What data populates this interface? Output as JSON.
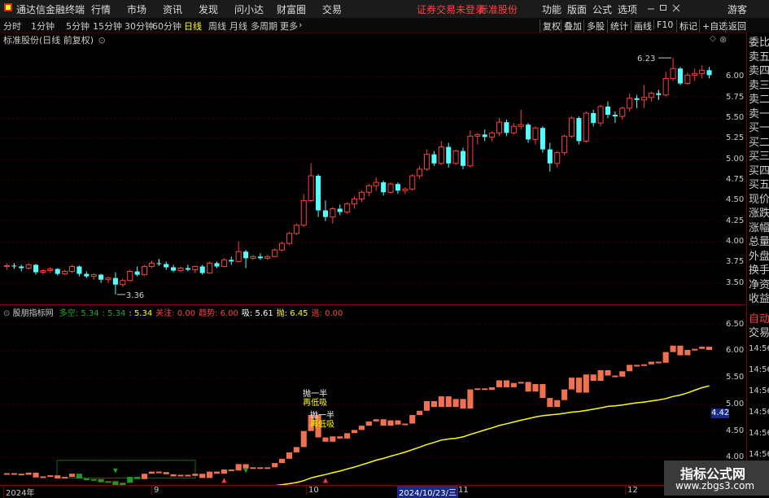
{
  "menubar": {
    "app_title": "通达信金融终端",
    "menus": [
      "行情",
      "市场",
      "资讯",
      "发现",
      "问小达",
      "财富圈",
      "交易"
    ],
    "status_warning": "证券交易未登录",
    "stock_name": "标准股份",
    "right_menus": [
      "功能",
      "版面",
      "公式",
      "选项"
    ],
    "user": "游客",
    "window_controls": [
      "minimize",
      "restore",
      "close"
    ]
  },
  "periodbar": {
    "periods": [
      "分时",
      "1分钟",
      "5分钟",
      "15分钟",
      "30分钟",
      "60分钟",
      "日线",
      "周线",
      "月线",
      "多周期",
      "更多"
    ],
    "active": "日线",
    "right_buttons": [
      "复权",
      "叠加",
      "多股",
      "统计",
      "画线",
      "F10",
      "标记",
      "+自选",
      "返回"
    ]
  },
  "main_chart": {
    "title": "标准股份(日线 前复权)",
    "high_label": "6.23",
    "low_label": "3.36",
    "price_axis": [
      "6.00",
      "5.75",
      "5.50",
      "5.25",
      "5.00",
      "4.75",
      "4.50",
      "4.25",
      "4.00",
      "3.75",
      "3.50"
    ]
  },
  "indicator": {
    "name": "股朋指标网",
    "vals": [
      {
        "label": "多空",
        "value": "5.34",
        "color": "#22aa22"
      },
      {
        "label": "",
        "value": "5.34",
        "color": "#22aa22"
      },
      {
        "label": "",
        "value": "5.34",
        "color": "#ffff00"
      },
      {
        "label": "关注",
        "value": "0.00",
        "color": "#ff4040"
      },
      {
        "label": "趋势",
        "value": "6.00",
        "color": "#ff4040"
      },
      {
        "label": "吸",
        "value": "5.61",
        "color": "#ffffff"
      },
      {
        "label": "抛",
        "value": "6.45",
        "color": "#ffff00"
      },
      {
        "label": "逃",
        "value": "0.00",
        "color": "#ff4040"
      }
    ],
    "axis": [
      "6.50",
      "6.00",
      "5.50",
      "5.00",
      "4.50",
      "4.00"
    ],
    "current_price": "4.42",
    "annotations": [
      {
        "text1": "抛一半",
        "text2": "再低吸"
      },
      {
        "text1": "抛一半",
        "text2": "再低吸"
      }
    ]
  },
  "time_axis": {
    "labels": [
      "2024年",
      "9",
      "10",
      "2024/10/23/三",
      "11",
      "12"
    ],
    "highlighted": "2024/10/23/三"
  },
  "right_panel": {
    "labels": [
      "委比",
      "卖五",
      "卖四",
      "卖三",
      "卖二",
      "卖一",
      "买一",
      "买二",
      "买三",
      "买四",
      "买五",
      "现价",
      "涨跌",
      "涨幅",
      "总量",
      "外盘",
      "换手",
      "净资",
      "收益"
    ],
    "auto_label": "自动",
    "trade_label": "交易",
    "time_ticks": [
      "14:56",
      "14:56",
      "14:56",
      "14:56",
      "14:56",
      "14:56",
      "14:56"
    ]
  },
  "watermark": {
    "title": "指标公式网",
    "url": "www.zbgs3.com"
  },
  "chart_data": {
    "type": "candlestick",
    "title": "标准股份(日线 前复权)",
    "series": [
      {
        "name": "",
        "candles": [
          [
            3.7,
            3.74,
            3.66,
            3.71
          ],
          [
            3.71,
            3.74,
            3.67,
            3.7
          ],
          [
            3.7,
            3.72,
            3.64,
            3.68
          ],
          [
            3.68,
            3.74,
            3.66,
            3.72
          ],
          [
            3.72,
            3.73,
            3.6,
            3.63
          ],
          [
            3.63,
            3.67,
            3.6,
            3.65
          ],
          [
            3.65,
            3.69,
            3.62,
            3.67
          ],
          [
            3.67,
            3.68,
            3.59,
            3.61
          ],
          [
            3.61,
            3.66,
            3.6,
            3.64
          ],
          [
            3.64,
            3.72,
            3.62,
            3.7
          ],
          [
            3.7,
            3.71,
            3.58,
            3.61
          ],
          [
            3.61,
            3.64,
            3.56,
            3.58
          ],
          [
            3.58,
            3.62,
            3.54,
            3.6
          ],
          [
            3.6,
            3.61,
            3.5,
            3.54
          ],
          [
            3.54,
            3.58,
            3.5,
            3.56
          ],
          [
            3.56,
            3.63,
            3.36,
            3.48
          ],
          [
            3.48,
            3.55,
            3.45,
            3.53
          ],
          [
            3.53,
            3.66,
            3.52,
            3.64
          ],
          [
            3.64,
            3.7,
            3.58,
            3.6
          ],
          [
            3.6,
            3.72,
            3.59,
            3.7
          ],
          [
            3.7,
            3.77,
            3.68,
            3.74
          ],
          [
            3.74,
            3.79,
            3.71,
            3.73
          ],
          [
            3.73,
            3.76,
            3.66,
            3.69
          ],
          [
            3.69,
            3.72,
            3.63,
            3.65
          ],
          [
            3.65,
            3.7,
            3.63,
            3.68
          ],
          [
            3.68,
            3.72,
            3.64,
            3.66
          ],
          [
            3.66,
            3.71,
            3.62,
            3.7
          ],
          [
            3.7,
            3.72,
            3.6,
            3.62
          ],
          [
            3.62,
            3.76,
            3.61,
            3.74
          ],
          [
            3.74,
            3.76,
            3.68,
            3.7
          ],
          [
            3.7,
            3.8,
            3.69,
            3.78
          ],
          [
            3.78,
            3.82,
            3.72,
            3.76
          ],
          [
            3.76,
            4.0,
            3.75,
            3.88
          ],
          [
            3.88,
            3.9,
            3.68,
            3.8
          ],
          [
            3.8,
            3.84,
            3.78,
            3.82
          ],
          [
            3.82,
            3.86,
            3.78,
            3.8
          ],
          [
            3.8,
            3.84,
            3.78,
            3.82
          ],
          [
            3.82,
            3.92,
            3.81,
            3.9
          ],
          [
            3.9,
            4.0,
            3.88,
            3.98
          ],
          [
            3.98,
            4.12,
            3.96,
            4.1
          ],
          [
            4.1,
            4.22,
            4.08,
            4.2
          ],
          [
            4.2,
            4.58,
            4.18,
            4.5
          ],
          [
            4.5,
            4.95,
            4.48,
            4.8
          ],
          [
            4.8,
            4.82,
            4.3,
            4.38
          ],
          [
            4.38,
            4.5,
            4.25,
            4.3
          ],
          [
            4.3,
            4.42,
            4.22,
            4.4
          ],
          [
            4.4,
            4.45,
            4.32,
            4.36
          ],
          [
            4.36,
            4.48,
            4.34,
            4.46
          ],
          [
            4.46,
            4.55,
            4.4,
            4.52
          ],
          [
            4.52,
            4.62,
            4.48,
            4.6
          ],
          [
            4.6,
            4.7,
            4.55,
            4.68
          ],
          [
            4.68,
            4.78,
            4.62,
            4.72
          ],
          [
            4.72,
            4.74,
            4.56,
            4.6
          ],
          [
            4.6,
            4.72,
            4.58,
            4.7
          ],
          [
            4.7,
            4.72,
            4.58,
            4.62
          ],
          [
            4.62,
            4.66,
            4.58,
            4.64
          ],
          [
            4.64,
            4.82,
            4.62,
            4.8
          ],
          [
            4.8,
            4.92,
            4.76,
            4.88
          ],
          [
            4.88,
            5.12,
            4.86,
            5.06
          ],
          [
            5.06,
            5.1,
            4.92,
            4.95
          ],
          [
            4.95,
            5.22,
            4.93,
            5.15
          ],
          [
            5.15,
            5.2,
            4.9,
            4.95
          ],
          [
            4.95,
            5.12,
            4.93,
            5.1
          ],
          [
            5.1,
            5.14,
            4.88,
            4.92
          ],
          [
            4.92,
            5.35,
            4.9,
            5.28
          ],
          [
            5.28,
            5.32,
            5.18,
            5.3
          ],
          [
            5.3,
            5.36,
            5.22,
            5.27
          ],
          [
            5.27,
            5.34,
            5.22,
            5.32
          ],
          [
            5.32,
            5.5,
            5.28,
            5.45
          ],
          [
            5.45,
            5.48,
            5.28,
            5.32
          ],
          [
            5.32,
            5.44,
            5.3,
            5.4
          ],
          [
            5.4,
            5.6,
            5.36,
            5.42
          ],
          [
            5.42,
            5.44,
            5.2,
            5.24
          ],
          [
            5.24,
            5.4,
            5.18,
            5.38
          ],
          [
            5.38,
            5.4,
            5.08,
            5.12
          ],
          [
            5.12,
            5.2,
            4.85,
            4.95
          ],
          [
            4.95,
            5.1,
            4.9,
            5.08
          ],
          [
            5.08,
            5.3,
            5.05,
            5.28
          ],
          [
            5.28,
            5.52,
            5.26,
            5.5
          ],
          [
            5.5,
            5.52,
            5.18,
            5.22
          ],
          [
            5.22,
            5.58,
            5.2,
            5.56
          ],
          [
            5.56,
            5.6,
            5.4,
            5.44
          ],
          [
            5.44,
            5.66,
            5.4,
            5.64
          ],
          [
            5.64,
            5.7,
            5.5,
            5.54
          ],
          [
            5.54,
            5.58,
            5.44,
            5.52
          ],
          [
            5.52,
            5.64,
            5.48,
            5.62
          ],
          [
            5.62,
            5.8,
            5.58,
            5.74
          ],
          [
            5.74,
            5.78,
            5.62,
            5.72
          ],
          [
            5.72,
            5.9,
            5.62,
            5.75
          ],
          [
            5.75,
            5.82,
            5.7,
            5.8
          ],
          [
            5.8,
            5.84,
            5.72,
            5.78
          ],
          [
            5.78,
            6.06,
            5.76,
            5.98
          ],
          [
            5.98,
            6.23,
            5.95,
            6.1
          ],
          [
            6.1,
            6.12,
            5.9,
            5.92
          ],
          [
            5.92,
            6.05,
            5.9,
            6.02
          ],
          [
            6.02,
            6.1,
            5.95,
            6.04
          ],
          [
            6.04,
            6.14,
            5.98,
            6.08
          ],
          [
            6.08,
            6.12,
            5.98,
            6.02
          ]
        ]
      }
    ],
    "ylabel": "",
    "ylim": [
      3.3,
      6.3
    ]
  }
}
